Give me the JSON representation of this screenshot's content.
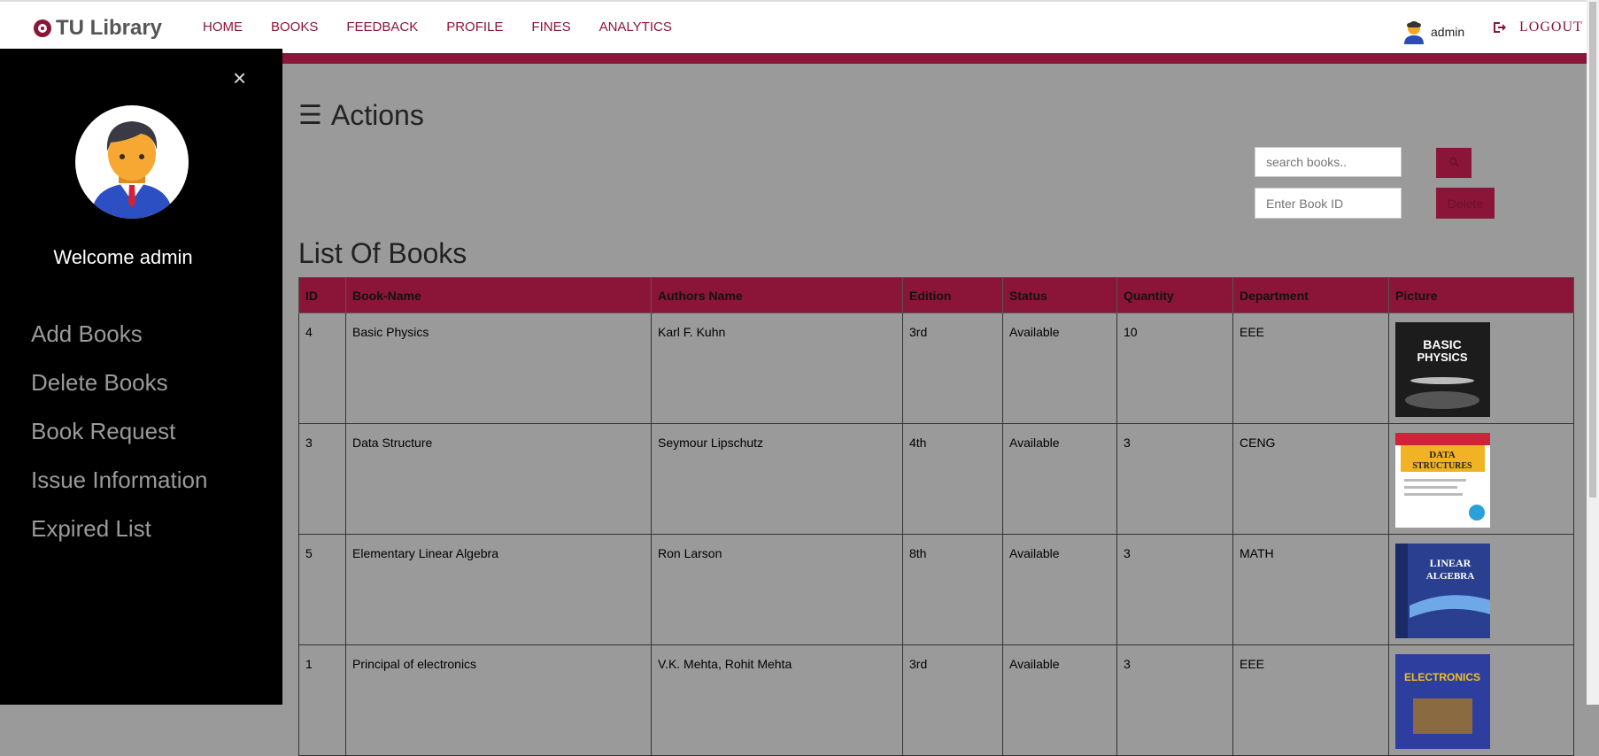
{
  "brand": {
    "name": "TU Library"
  },
  "nav": {
    "items": [
      "HOME",
      "BOOKS",
      "FEEDBACK",
      "PROFILE",
      "FINES",
      "ANALYTICS"
    ]
  },
  "user": {
    "name": "admin",
    "logout": "LOGOUT"
  },
  "sidebar": {
    "close": "×",
    "welcome": "Welcome admin",
    "items": [
      "Add Books",
      "Delete Books",
      "Book Request",
      "Issue Information",
      "Expired List"
    ]
  },
  "main": {
    "actions_icon": "☰",
    "actions_title": "Actions",
    "search_placeholder": "search books..",
    "bookid_placeholder": "Enter Book ID",
    "delete_label": "Delete",
    "list_title": "List Of Books"
  },
  "table": {
    "headers": [
      "ID",
      "Book-Name",
      "Authors Name",
      "Edition",
      "Status",
      "Quantity",
      "Department",
      "Picture"
    ],
    "rows": [
      [
        "4",
        "Basic Physics",
        "Karl F. Kuhn",
        "3rd",
        "Available",
        "10",
        "EEE"
      ],
      [
        "3",
        "Data Structure",
        "Seymour Lipschutz",
        "4th",
        "Available",
        "3",
        "CENG"
      ],
      [
        "5",
        "Elementary Linear Algebra",
        "Ron Larson",
        "8th",
        "Available",
        "3",
        "MATH"
      ],
      [
        "1",
        "Principal of electronics",
        "V.K. Mehta, Rohit Mehta",
        "3rd",
        "Available",
        "3",
        "EEE"
      ]
    ],
    "covers": [
      {
        "bg": "#1c1c1c",
        "text": "BASIC PHYSICS"
      },
      {
        "bg": "#f0b323",
        "text": "DATA STRUCTURES"
      },
      {
        "bg": "#2a3f8f",
        "text": "LINEAR ALGEBRA"
      },
      {
        "bg": "#2e3e9e",
        "text": "ELECTRONICS"
      }
    ]
  },
  "colors": {
    "accent": "#8b1538",
    "sidebar": "#000000",
    "main_bg": "#9a9a9a"
  }
}
